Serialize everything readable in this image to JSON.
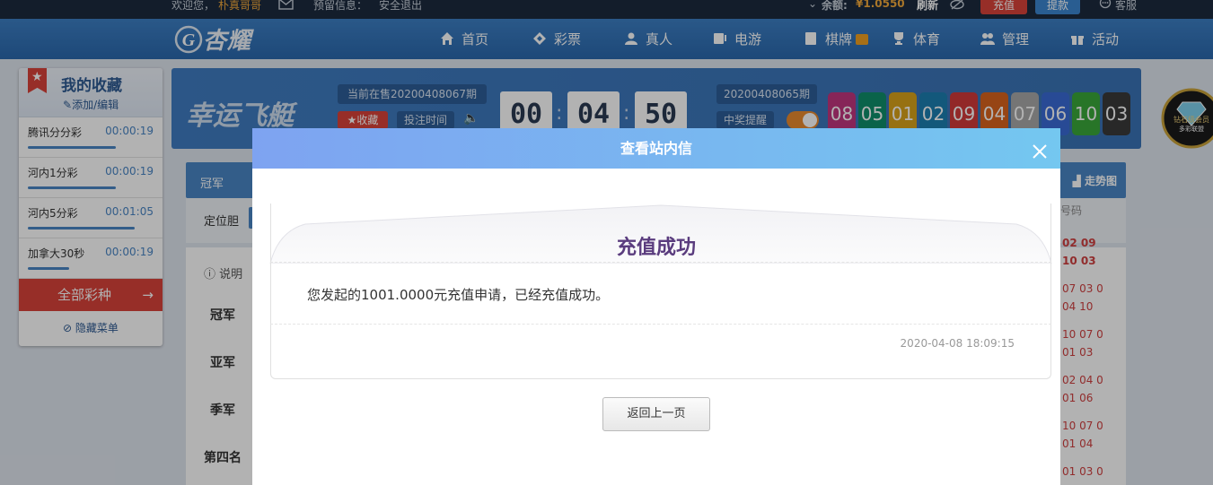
{
  "topbar": {
    "welcome": "欢迎您，",
    "username": "朴真哥哥",
    "reserved_label": "预留信息：",
    "logout": "安全退出",
    "balance_label": "余额:",
    "balance_value": "¥1.0550",
    "refresh": "刷新",
    "recharge": "充值",
    "withdraw": "提款",
    "service": "客服"
  },
  "nav": {
    "logo": "杏耀",
    "items": [
      {
        "label": "首页",
        "icon": "home-icon"
      },
      {
        "label": "彩票",
        "icon": "ticket-icon"
      },
      {
        "label": "真人",
        "icon": "person-icon"
      },
      {
        "label": "电游",
        "icon": "game-icon"
      },
      {
        "label": "棋牌",
        "icon": "cards-icon"
      },
      {
        "label": "体育",
        "icon": "trophy-icon"
      },
      {
        "label": "管理",
        "icon": "users-icon"
      },
      {
        "label": "活动",
        "icon": "gift-icon"
      }
    ]
  },
  "favorites": {
    "title": "我的收藏",
    "edit": "添加/编辑",
    "items": [
      {
        "name": "腾讯分分彩",
        "time": "00:00:19",
        "progress": 0.7
      },
      {
        "name": "河内1分彩",
        "time": "00:00:19",
        "progress": 0.7
      },
      {
        "name": "河内5分彩",
        "time": "00:01:05",
        "progress": 0.85
      },
      {
        "name": "加拿大30秒",
        "time": "00:00:19",
        "progress": 0.33
      }
    ],
    "all_games": "全部彩种",
    "hide_menu": "隐藏菜单"
  },
  "game": {
    "name": "幸运飞艇",
    "current_issue": "当前在售20200408067期",
    "collect": "收藏",
    "bet_time": "投注时间",
    "countdown": [
      "00",
      "04",
      "50"
    ],
    "last_issue": "20200408065期",
    "win_remind": "中奖提醒",
    "balls": [
      "08",
      "05",
      "01",
      "02",
      "09",
      "04",
      "07",
      "06",
      "10",
      "03"
    ],
    "ball_colors": [
      "#c0357e",
      "#0f8f6a",
      "#d9a21a",
      "#1c7fb0",
      "#d23a3a",
      "#d8641e",
      "#a8a8a8",
      "#3a6bd6",
      "#3aa83a",
      "#3a3a3a"
    ]
  },
  "bet": {
    "tabs": [
      "冠军"
    ],
    "label": "定位胆",
    "trend": "走势图",
    "explain": "说明",
    "ranks": [
      "冠军",
      "亚军",
      "季军",
      "第四名"
    ],
    "history_header": "号码",
    "history_lines": [
      "02 09",
      "10 03",
      "07 03 0",
      "04 10",
      "10 07 0",
      "01 03",
      "02 04 0",
      "01 06",
      "10 07 0",
      "01 04",
      "01 03 0"
    ]
  },
  "badge": {
    "line1": "钻石级会员",
    "line2": "多彩联盟"
  },
  "modal": {
    "title": "查看站内信",
    "message_title": "充值成功",
    "message_body": "您发起的1001.0000元充值申请，已经充值成功。",
    "message_date": "2020-04-08 18:09:15",
    "back_button": "返回上一页"
  }
}
